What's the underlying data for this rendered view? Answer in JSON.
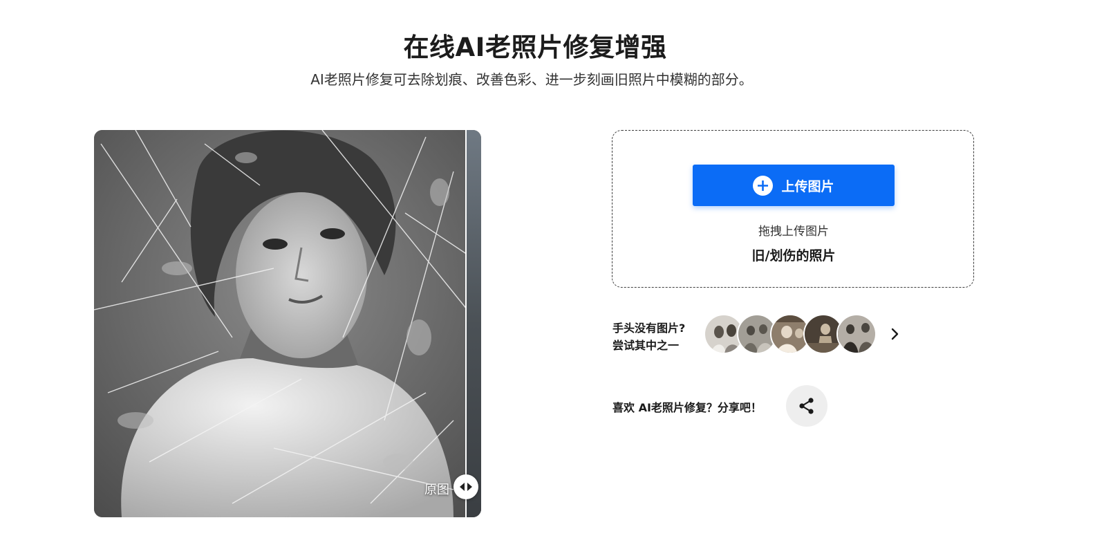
{
  "header": {
    "title": "在线AI老照片修复增强",
    "subtitle": "AI老照片修复可去除划痕、改善色彩、进一步刻画旧照片中模糊的部分。"
  },
  "preview": {
    "original_label": "原图"
  },
  "upload": {
    "button_label": "上传图片",
    "drag_hint": "拖拽上传图片",
    "accepted_type": "旧/划伤的照片"
  },
  "samples": {
    "prompt_line1": "手头没有图片?",
    "prompt_line2": "尝试其中之一"
  },
  "share": {
    "label": "喜欢 AI老照片修复？分享吧！"
  },
  "colors": {
    "accent": "#0b6cf6",
    "share_bg": "#eeeeee"
  }
}
